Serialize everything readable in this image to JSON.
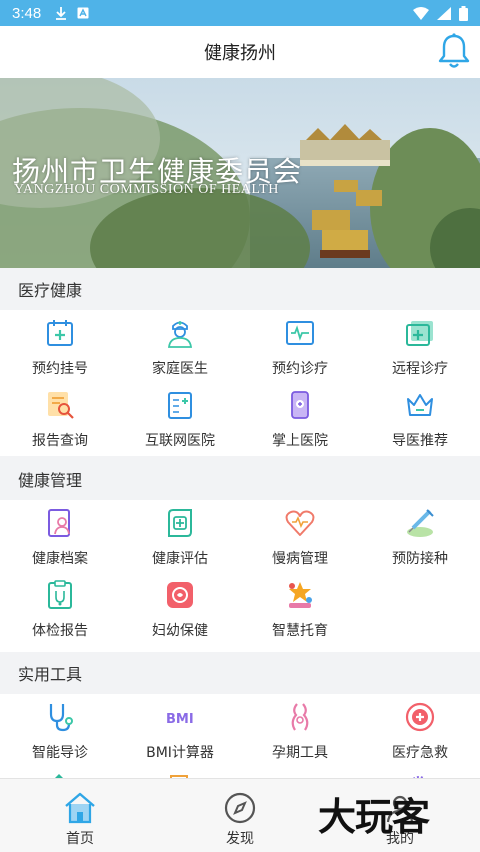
{
  "status_bar": {
    "time": "3:48"
  },
  "header": {
    "title": "健康扬州"
  },
  "banner": {
    "title": "扬州市卫生健康委员会",
    "subtitle": "YANGZHOU COMMISSION OF HEALTH"
  },
  "sections": [
    {
      "title": "医疗健康",
      "items": [
        {
          "label": "预约挂号",
          "icon": "calendar-plus-icon"
        },
        {
          "label": "家庭医生",
          "icon": "doctor-icon"
        },
        {
          "label": "预约诊疗",
          "icon": "medical-card-icon"
        },
        {
          "label": "远程诊疗",
          "icon": "remote-consult-icon"
        },
        {
          "label": "报告查询",
          "icon": "report-search-icon"
        },
        {
          "label": "互联网医院",
          "icon": "online-hospital-icon"
        },
        {
          "label": "掌上医院",
          "icon": "mobile-hospital-icon"
        },
        {
          "label": "导医推荐",
          "icon": "crown-icon"
        }
      ]
    },
    {
      "title": "健康管理",
      "items": [
        {
          "label": "健康档案",
          "icon": "health-record-icon"
        },
        {
          "label": "健康评估",
          "icon": "health-assessment-icon"
        },
        {
          "label": "慢病管理",
          "icon": "heart-rate-icon"
        },
        {
          "label": "预防接种",
          "icon": "vaccine-icon"
        },
        {
          "label": "体检报告",
          "icon": "checkup-report-icon"
        },
        {
          "label": "妇幼保健",
          "icon": "maternal-child-icon"
        },
        {
          "label": "智慧托育",
          "icon": "childcare-icon"
        }
      ]
    },
    {
      "title": "实用工具",
      "items": [
        {
          "label": "智能导诊",
          "icon": "stethoscope-icon"
        },
        {
          "label": "BMI计算器",
          "icon": "bmi-icon"
        },
        {
          "label": "孕期工具",
          "icon": "pregnancy-icon"
        },
        {
          "label": "医疗急救",
          "icon": "first-aid-icon"
        }
      ]
    }
  ],
  "tabs": [
    {
      "label": "首页",
      "icon": "home-icon",
      "active": true
    },
    {
      "label": "发现",
      "icon": "compass-icon",
      "active": false
    },
    {
      "label": "我的",
      "icon": "profile-icon",
      "active": false
    }
  ],
  "watermark": "大玩客",
  "colors": {
    "accent": "#2fa6e6",
    "status_bar": "#4fb3e8",
    "section_bg": "#f2f3f5"
  }
}
